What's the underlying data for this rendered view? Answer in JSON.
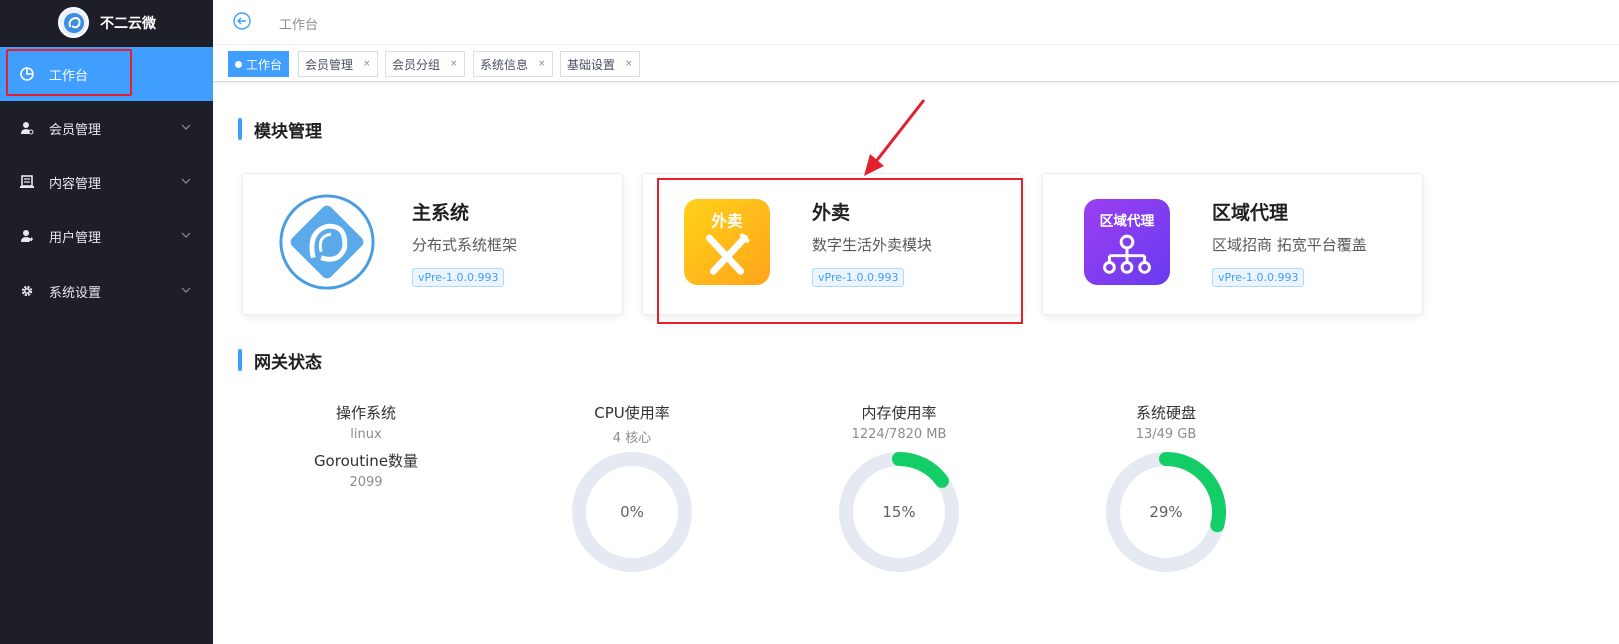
{
  "app": {
    "name": "不二云微"
  },
  "sidebar": {
    "items": [
      {
        "label": "工作台",
        "icon": "dashboard-icon",
        "active": true
      },
      {
        "label": "会员管理",
        "icon": "member-icon",
        "active": false
      },
      {
        "label": "内容管理",
        "icon": "content-icon",
        "active": false
      },
      {
        "label": "用户管理",
        "icon": "user-icon",
        "active": false
      },
      {
        "label": "系统设置",
        "icon": "gear-icon",
        "active": false
      }
    ]
  },
  "header": {
    "breadcrumb": "工作台",
    "back_icon": "back-arrow-icon"
  },
  "tabs": [
    {
      "label": "工作台",
      "active": true
    },
    {
      "label": "会员管理",
      "close": "×"
    },
    {
      "label": "会员分组",
      "close": "×"
    },
    {
      "label": "系统信息",
      "close": "×"
    },
    {
      "label": "基础设置",
      "close": "×"
    }
  ],
  "modules": {
    "title": "模块管理",
    "cards": [
      {
        "name": "主系统",
        "desc": "分布式系统框架",
        "version": "vPre-1.0.0.993",
        "icon": "main-system-logo-icon"
      },
      {
        "name": "外卖",
        "desc": "数字生活外卖模块",
        "version": "vPre-1.0.0.993",
        "icon": "takeaway-icon",
        "icon_text": "外卖"
      },
      {
        "name": "区域代理",
        "desc": "区域招商 拓宽平台覆盖",
        "version": "vPre-1.0.0.993",
        "icon": "region-agent-icon",
        "icon_text": "区域代理"
      }
    ]
  },
  "gateway": {
    "title": "网关状态",
    "os": {
      "label": "操作系统",
      "value": "linux"
    },
    "goroutine": {
      "label": "Goroutine数量",
      "value": "2099"
    },
    "cpu": {
      "label": "CPU使用率",
      "detail": "4 核心",
      "percent_text": "0%",
      "percent": 0
    },
    "memory": {
      "label": "内存使用率",
      "detail": "1224/7820 MB",
      "percent_text": "15%",
      "percent": 15
    },
    "disk": {
      "label": "系统硬盘",
      "detail": "13/49 GB",
      "percent_text": "29%",
      "percent": 29
    }
  },
  "colors": {
    "sidebar_bg": "#1d1e27",
    "accent": "#409eff",
    "gauge_track": "#e5e9f2",
    "gauge_fill": "#13ce66",
    "highlight": "#e5202e"
  }
}
